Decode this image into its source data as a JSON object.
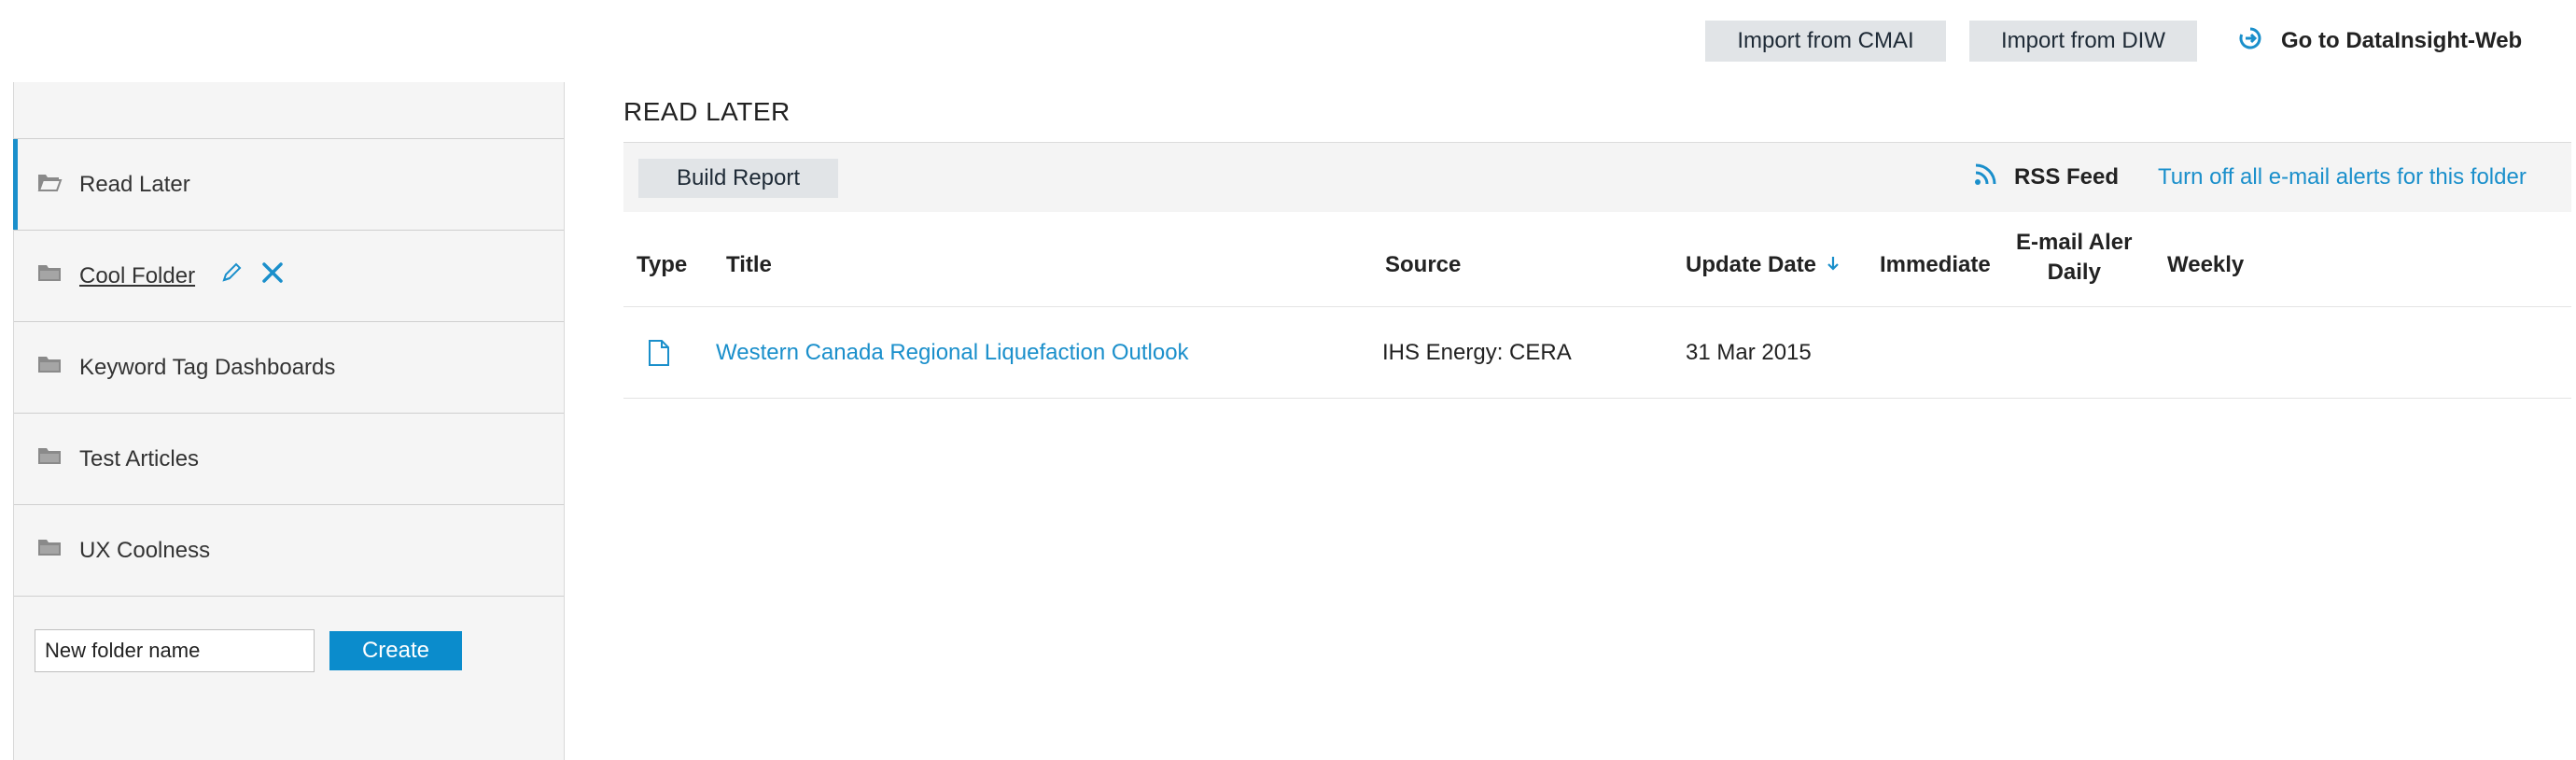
{
  "topbar": {
    "import_cmai": "Import from CMAI",
    "import_diw": "Import from DIW",
    "goto_label": "Go to DataInsight-Web"
  },
  "sidebar": {
    "items": [
      {
        "label": "Read Later",
        "active": true
      },
      {
        "label": "Cool Folder",
        "editable": true
      },
      {
        "label": "Keyword Tag Dashboards"
      },
      {
        "label": "Test Articles"
      },
      {
        "label": "UX Coolness"
      }
    ],
    "new_folder_placeholder": "New folder name",
    "new_folder_value": "New folder name",
    "create_label": "Create"
  },
  "main": {
    "title": "READ LATER",
    "build_report": "Build Report",
    "rss_label": "RSS Feed",
    "alerts_link": "Turn off all e-mail alerts for this folder",
    "columns": {
      "type": "Type",
      "title": "Title",
      "source": "Source",
      "update_date": "Update Date",
      "immediate": "Immediate",
      "email_line1": "E-mail Aler",
      "email_line2": "Daily",
      "weekly": "Weekly"
    },
    "rows": [
      {
        "title": "Western Canada Regional Liquefaction Outlook",
        "source": "IHS Energy: CERA",
        "date": "31 Mar 2015"
      }
    ]
  },
  "colors": {
    "accent": "#1a8fcb",
    "button_bg": "#e1e4e7",
    "sidebar_bg": "#f5f5f5"
  },
  "icons": {
    "goto": "circle-arrow-icon",
    "rss": "rss-icon",
    "folder": "folder-icon",
    "edit": "pencil-icon",
    "delete": "close-icon",
    "sort": "arrow-down-icon",
    "document": "document-icon"
  }
}
